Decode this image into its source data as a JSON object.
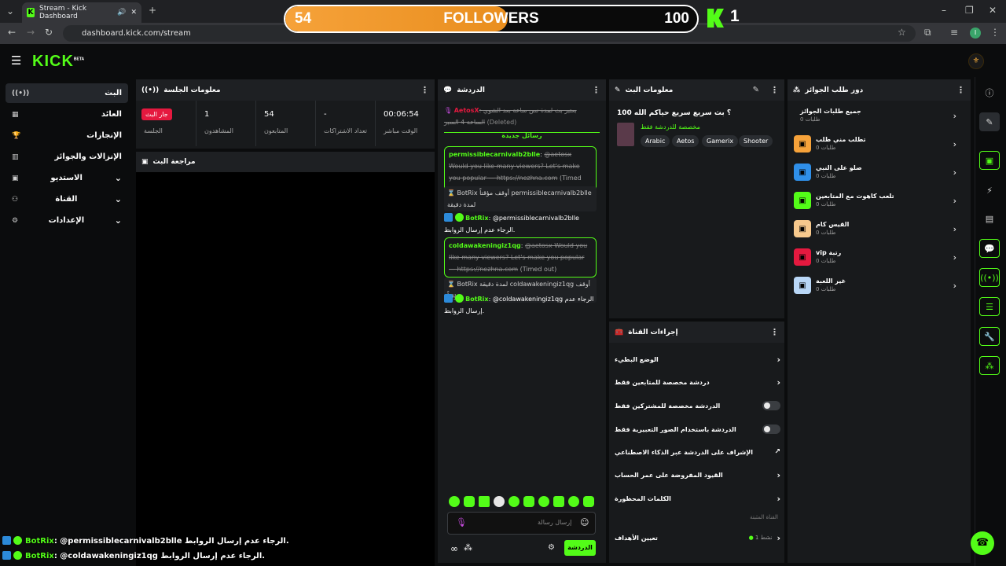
{
  "browser": {
    "tab_title": "Stream - Kick Dashboard",
    "url": "dashboard.kick.com/stream"
  },
  "overlay": {
    "followers_current": "54",
    "followers_label": "FOLLOWERS",
    "followers_goal": "100",
    "progress_fraction": 0.54,
    "k_count": "1",
    "chat_lines": [
      {
        "user": "BotRix",
        "text": ": @permissiblecarnivalb2blle الرجاء عدم إرسال الروابط."
      },
      {
        "user": "BotRix",
        "text": ": @coldawakeningiz1qg الرجاء عدم إرسال الروابط."
      }
    ]
  },
  "app": {
    "logo": "KICK",
    "logo_tag": "BETA"
  },
  "sidebar": {
    "items": [
      {
        "label": "البث",
        "icon": "((•))"
      },
      {
        "label": "العائد",
        "icon": "▦"
      },
      {
        "label": "الإنجازات",
        "icon": "🏆"
      },
      {
        "label": "الإنزالات والجوائز",
        "icon": "▥"
      },
      {
        "label": "الاستديو",
        "icon": "▣"
      },
      {
        "label": "القناة",
        "icon": "⚇"
      },
      {
        "label": "الإعدادات",
        "icon": "⚙"
      }
    ]
  },
  "session": {
    "title": "معلومات الجلسة",
    "live_badge": "جار البث",
    "stats": [
      {
        "value": "00:06:54",
        "label": "الوقت مباشر"
      },
      {
        "value": "-",
        "label": "تعداد الاشتراكات"
      },
      {
        "value": "54",
        "label": "المتابعون"
      },
      {
        "value": "1",
        "label": "المشاهدون"
      },
      {
        "value": "",
        "label": "الجلسة"
      }
    ],
    "preview_title": "مراجعة البث"
  },
  "chat": {
    "title": "الدردشة",
    "deleted_user": "AetosX",
    "deleted_text": ": بعتبر بث لمدة نص ساعة بعد الشوي الساعة 4 السبر",
    "deleted_tag": "(Deleted)",
    "new_messages": "رسائل جديدة",
    "msg1_user": "permissiblecarnivalb2blle",
    "msg1_text": "@aetosx Would you like many viewers? Let's make you popular — https://nezhna.com",
    "timed_out": "(Timed out)",
    "sys1": "BotRix أوقف مؤقتاً permissiblecarnivalb2blle لمدة دقيقة",
    "bot1_user": "BotRix",
    "bot1_text": ": @permissiblecarnivalb2blle الرجاء عدم إرسال الروابط.",
    "msg2_user": "coldawakeningiz1qg",
    "msg2_text": "@aetosx Would you like many viewers? Let's make you popular — https://nezhna.com",
    "sys2": "BotRix لمدة دقيقة coldawakeningiz1qg أوقف مؤقتاً",
    "bot2_user": "BotRix",
    "bot2_text": ": @coldawakeningiz1qg الرجاء عدم إرسال الروابط.",
    "input_placeholder": "إرسال رسالة",
    "send_label": "الدردشة"
  },
  "stream_info": {
    "title_label": "معلومات البث",
    "stream_title": "100 ؟ بث سريع سريع حياكم الله",
    "category": "مخصصة للدردشة فقط",
    "tags": [
      "Arabic",
      "Aetos",
      "Gamerix",
      "Shooter"
    ]
  },
  "channel_actions": {
    "title": "إجراءات القناة",
    "items": [
      {
        "label": "الوضع البطيء",
        "kind": "chevron"
      },
      {
        "label": "دردشة مخصصة للمتابعين فقط",
        "kind": "chevron"
      },
      {
        "label": "الدردشة مخصصة للمشتركين فقط",
        "kind": "toggle"
      },
      {
        "label": "الدردشة باستخدام الصور التعبيرية فقط",
        "kind": "toggle"
      },
      {
        "label": "الإشراف على الدردشة عبر الذكاء الاصطناعي",
        "kind": "link"
      },
      {
        "label": "القيود المفروضة على عمر الحساب",
        "kind": "chevron"
      },
      {
        "label": "الكلمات المحظورة",
        "kind": "chevron"
      }
    ],
    "pinned_label": "القناة المثبتة",
    "goals_label": "تعيين الأهداف",
    "goals_status": "نشط 1"
  },
  "rewards": {
    "title": "دور طلب الجوائز",
    "all_label": "جميع طلبات الجوائز",
    "all_sub": "طلبات 0",
    "items": [
      {
        "label": "تطلب مني طلب",
        "sub": "طلبات 0",
        "color": "#f6a23a"
      },
      {
        "label": "صلو على النبي",
        "sub": "طلبات 0",
        "color": "#2f8fe8"
      },
      {
        "label": "تلعب كاهوت مع المتابعين",
        "sub": "طلبات 0",
        "color": "#53fc18"
      },
      {
        "label": "القيس كام",
        "sub": "طلبات 0",
        "color": "#f7c98d"
      },
      {
        "label": "vip رتبة",
        "sub": "طلبات 0",
        "color": "#e5193f"
      },
      {
        "label": "غير اللعبة",
        "sub": "طلبات 0",
        "color": "#b9d7f7"
      }
    ]
  },
  "colors": {
    "accent": "#53fc18",
    "live": "#e5193f",
    "panel": "#181a1c"
  }
}
